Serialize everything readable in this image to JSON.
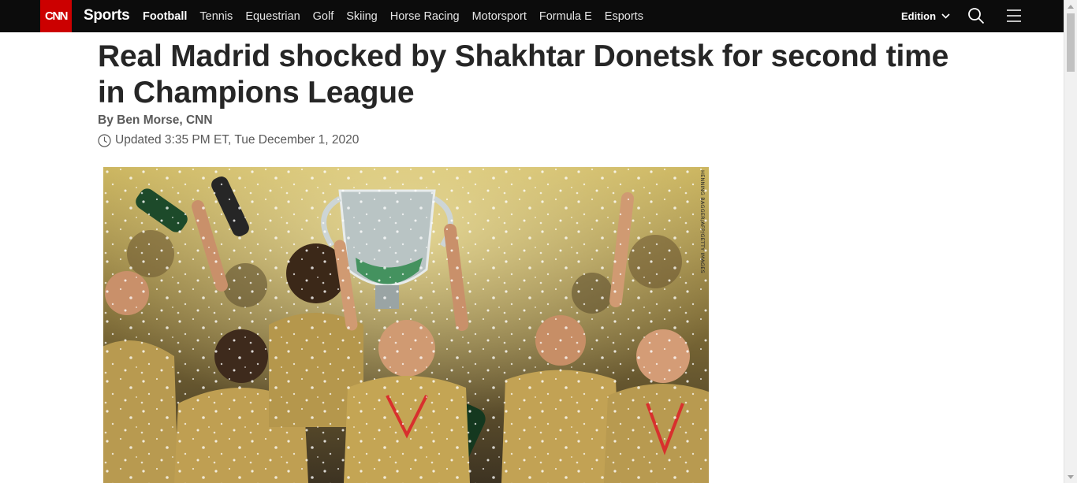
{
  "nav": {
    "logo_text": "CNN",
    "section_title": "Sports",
    "items": [
      {
        "label": "Football",
        "active": true
      },
      {
        "label": "Tennis"
      },
      {
        "label": "Equestrian"
      },
      {
        "label": "Golf"
      },
      {
        "label": "Skiing"
      },
      {
        "label": "Horse Racing"
      },
      {
        "label": "Motorsport"
      },
      {
        "label": "Formula E"
      },
      {
        "label": "Esports"
      }
    ],
    "edition_label": "Edition",
    "icons": [
      "chevron-down-icon",
      "search-icon",
      "hamburger-menu-icon"
    ]
  },
  "article": {
    "headline": "Real Madrid shocked by Shakhtar Donetsk for second time in Champions League",
    "byline": "By Ben Morse, CNN",
    "updated": "Updated 3:35 PM ET, Tue December 1, 2020",
    "hero_credit": "HENNING BAGGER/AFP/GETTY IMAGES"
  },
  "colors": {
    "nav_background": "#0c0c0c",
    "brand_red": "#cc0000",
    "headline_text": "#262626",
    "meta_text": "#595959"
  }
}
